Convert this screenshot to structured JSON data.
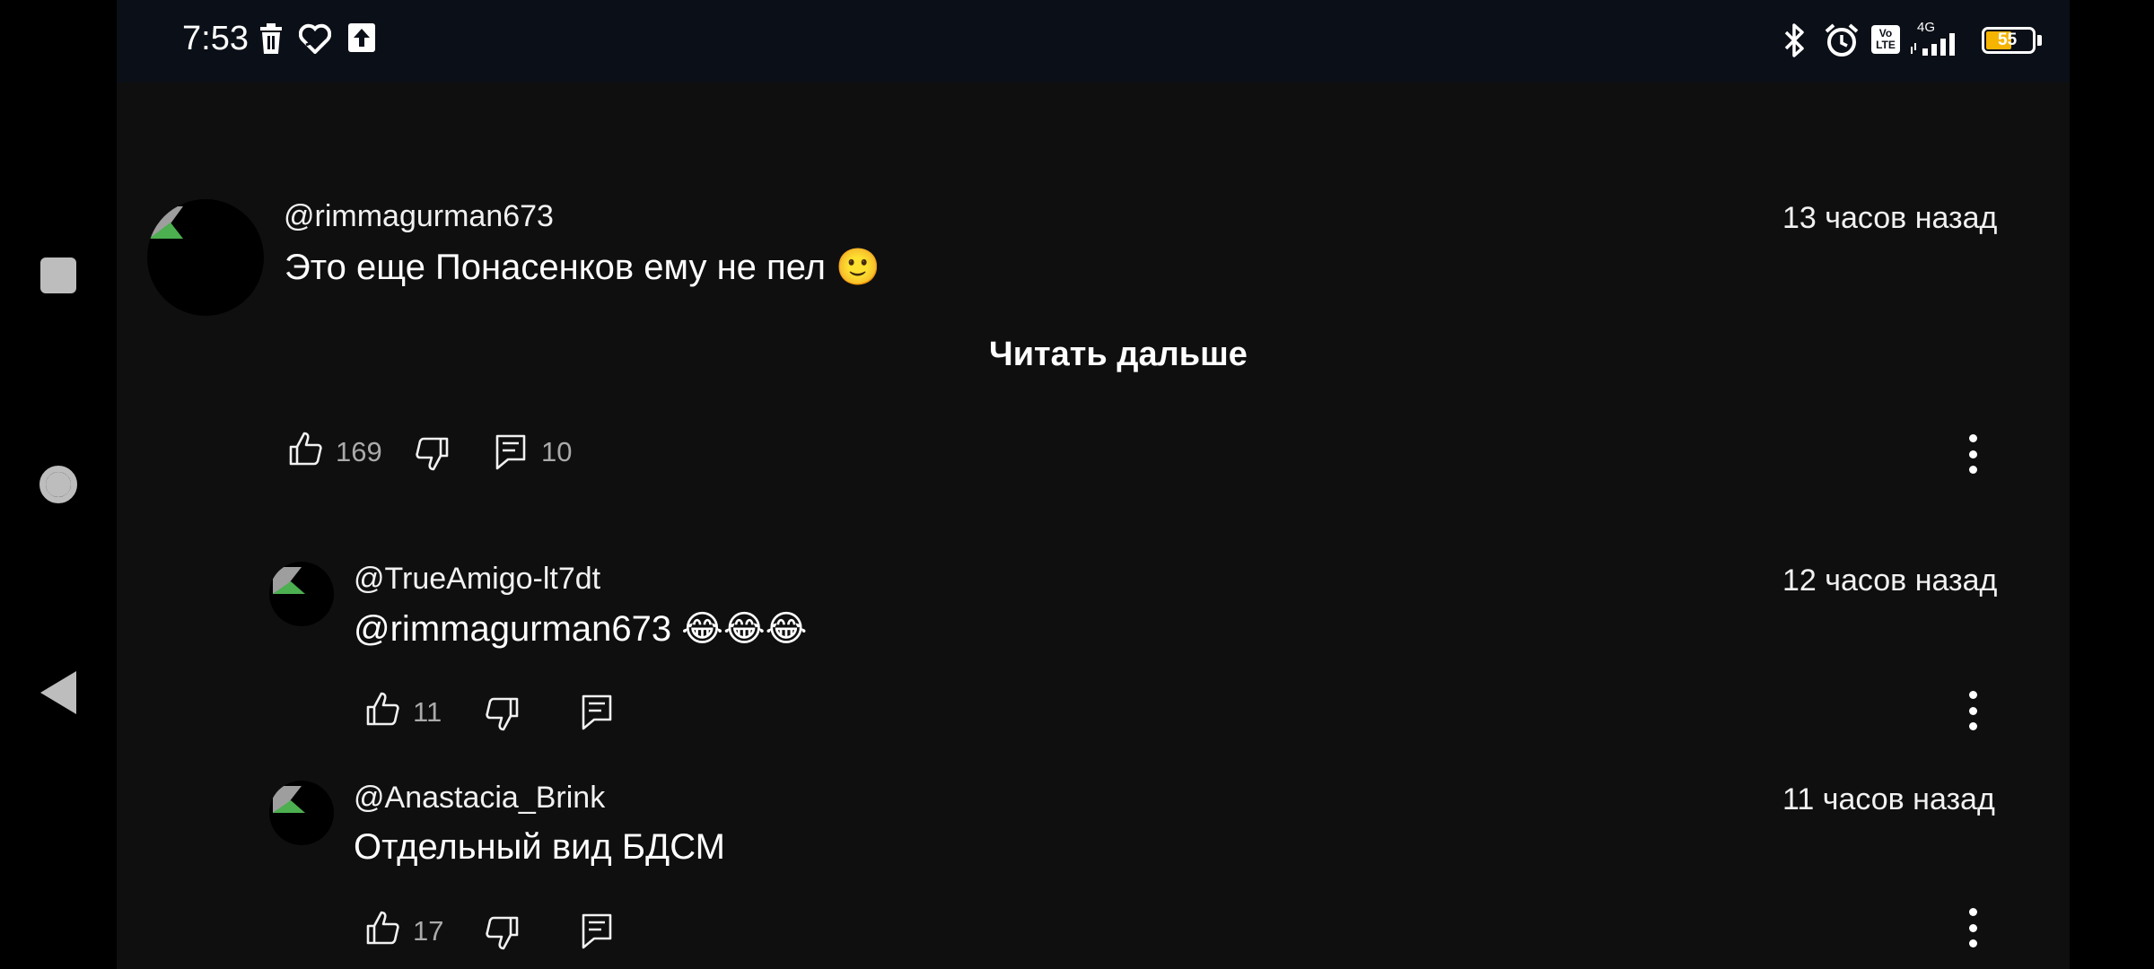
{
  "status_bar": {
    "time": "7:53",
    "left_icons": [
      "trash-icon",
      "health-icon",
      "upload-icon"
    ],
    "right_icons": [
      "bluetooth-icon",
      "alarm-icon",
      "volte-icon",
      "signal-4g-icon",
      "battery-icon"
    ],
    "network": "4G",
    "volte_label": "Vo LTE",
    "battery_level": "55"
  },
  "navigation": {
    "items": [
      "recents-button",
      "home-button",
      "back-button"
    ]
  },
  "comments": [
    {
      "username": "@rimmagurman673",
      "timestamp": "13 часов назад",
      "text": "Это еще Понасенков ему не пел 🙂",
      "read_more": "Читать дальше",
      "likes": "169",
      "replies": "10"
    },
    {
      "username": "@TrueAmigo-lt7dt",
      "timestamp": "12 часов назад",
      "text": "@rimmagurman673  😂😂😂",
      "likes": "11"
    },
    {
      "username": "@Anastacia_Brink",
      "timestamp": "11 часов назад",
      "text": "Отдельный вид БДСМ",
      "likes": "17"
    }
  ],
  "colors": {
    "background": "#0f0f0f",
    "text": "#f1f1f1",
    "secondary_text": "#aaaaaa",
    "battery": "#f5b400"
  }
}
